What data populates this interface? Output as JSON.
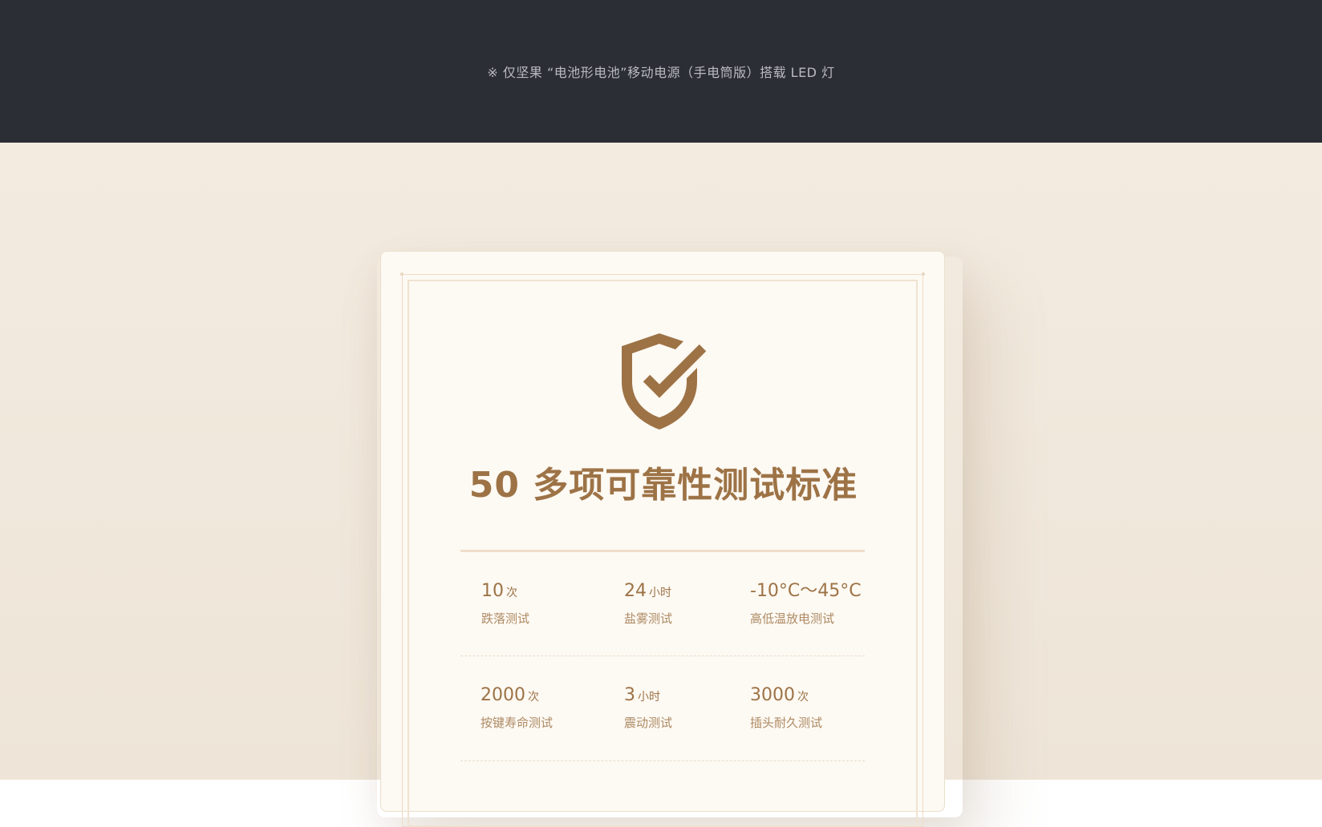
{
  "header": {
    "footnote": "※ 仅坚果 “电池形电池”移动电源（手电筒版）搭载 LED 灯"
  },
  "card": {
    "icon": "shield-check-icon",
    "title": "50 多项可靠性测试标准",
    "stats": [
      {
        "value": "10",
        "unit": "次",
        "label": "跌落测试"
      },
      {
        "value": "24",
        "unit": "小时",
        "label": "盐雾测试"
      },
      {
        "value": "-10°C〜45°C",
        "unit": "",
        "label": "高低温放电测试"
      },
      {
        "value": "2000",
        "unit": "次",
        "label": "按键寿命测试"
      },
      {
        "value": "3",
        "unit": "小时",
        "label": "震动测试"
      },
      {
        "value": "3000",
        "unit": "次",
        "label": "插头耐久测试"
      }
    ]
  },
  "colors": {
    "dark_band": "#2b2e35",
    "accent": "#9d7346",
    "page_background": "#f3ebe0",
    "card_background": "#fdf9f3"
  }
}
